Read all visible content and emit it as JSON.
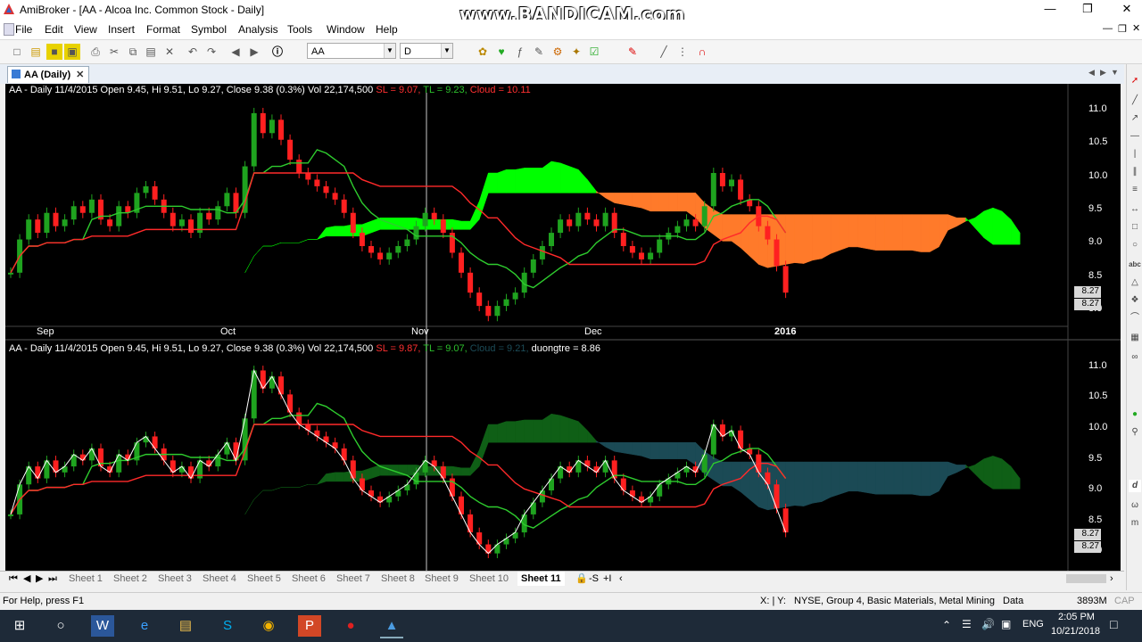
{
  "window": {
    "title": "AmiBroker - [AA - Alcoa Inc. Common Stock - Daily]",
    "watermark": "www.BANDICAM.com"
  },
  "menu": [
    "File",
    "Edit",
    "View",
    "Insert",
    "Format",
    "Symbol",
    "Analysis",
    "Tools",
    "Window",
    "Help"
  ],
  "toolbar": {
    "symbol": "AA",
    "interval": "D"
  },
  "tab": {
    "label": "AA (Daily)"
  },
  "panel1": {
    "info_prefix": "AA - Daily 11/4/2015 Open 9.45, Hi 9.51, Lo 9.27, Close 9.38 (0.3%) Vol 22,174,500",
    "sl": "SL = 9.07,",
    "tl": "TL = 9.23,",
    "cloud": "Cloud = 10.11",
    "yticks": [
      "11.0",
      "10.5",
      "10.0",
      "9.5",
      "9.0",
      "8.5",
      "8.0"
    ],
    "price_labels": [
      "8.27",
      "8.27"
    ],
    "xticks": [
      "Sep",
      "Oct",
      "Nov",
      "Dec",
      "2016"
    ]
  },
  "panel2": {
    "info_prefix": "AA - Daily 11/4/2015 Open 9.45, Hi 9.51, Lo 9.27, Close 9.38 (0.3%) Vol 22,174,500",
    "sl": "SL = 9.87,",
    "tl": "TL = 9.07,",
    "cloud": "Cloud = 9.21,",
    "duongtre": "duongtre = 8.86",
    "yticks": [
      "11.0",
      "10.5",
      "10.0",
      "9.5",
      "9.0",
      "8.5",
      "8.0"
    ],
    "price_labels": [
      "8.27",
      "8.27"
    ]
  },
  "sheets": [
    "Sheet 1",
    "Sheet 2",
    "Sheet 3",
    "Sheet 4",
    "Sheet 5",
    "Sheet 6",
    "Sheet 7",
    "Sheet 8",
    "Sheet 9",
    "Sheet 10",
    "Sheet 11"
  ],
  "status": {
    "help": "For Help, press F1",
    "xy": "X:  | Y:",
    "info": "NYSE, Group 4, Basic Materials, Metal Mining",
    "data": "Data",
    "mem": "3893M",
    "cap": "CAP"
  },
  "taskbar": {
    "lang": "ENG",
    "time": "2:05 PM",
    "date": "10/21/2018"
  },
  "colors": {
    "bull": "#1fa31f",
    "bear": "#ff2020",
    "cloud_up": "#00ff00",
    "cloud_down": "#ff7a2a",
    "cloud2_green": "#0f5f16",
    "cloud2_teal": "#1b4a55"
  },
  "chart_data": {
    "type": "candlestick",
    "symbol": "AA",
    "ylim": [
      7.9,
      11.2
    ],
    "closes": [
      8.6,
      9.1,
      9.4,
      9.2,
      9.5,
      9.3,
      9.4,
      9.6,
      9.5,
      9.7,
      9.4,
      9.3,
      9.6,
      9.5,
      9.8,
      9.9,
      9.7,
      9.5,
      9.3,
      9.4,
      9.2,
      9.5,
      9.4,
      9.6,
      9.8,
      9.5,
      10.2,
      11.0,
      10.7,
      10.9,
      10.6,
      10.3,
      10.1,
      10.0,
      9.9,
      9.8,
      9.7,
      9.5,
      9.2,
      9.0,
      8.9,
      8.8,
      8.9,
      9.0,
      9.1,
      9.3,
      9.5,
      9.4,
      9.2,
      8.9,
      8.6,
      8.3,
      8.1,
      7.95,
      8.1,
      8.2,
      8.3,
      8.6,
      8.8,
      9.0,
      9.2,
      9.4,
      9.3,
      9.5,
      9.4,
      9.3,
      9.5,
      9.2,
      9.0,
      8.9,
      8.8,
      8.9,
      9.1,
      9.2,
      9.3,
      9.4,
      9.3,
      9.6,
      10.1,
      9.9,
      10.0,
      9.7,
      9.6,
      9.3,
      9.1,
      8.7,
      8.3
    ]
  }
}
